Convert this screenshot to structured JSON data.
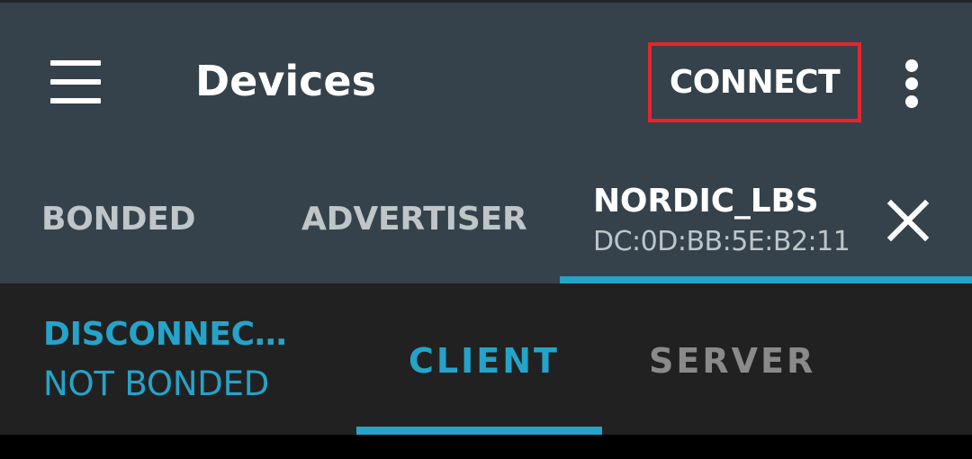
{
  "app_bar": {
    "title": "Devices",
    "menu_icon": "hamburger-menu-icon",
    "connect_label": "CONNECT",
    "overflow_icon": "more-vert-icon"
  },
  "device_tabs": {
    "bonded_label": "BONDED",
    "advertiser_label": "ADVERTISER",
    "active_device_name": "NORDIC_LBS",
    "active_device_address": "DC:0D:BB:5E:B2:11",
    "close_icon": "close-icon"
  },
  "connection": {
    "status": "DISCONNEC…",
    "bond_state": "NOT BONDED"
  },
  "sub_tabs": {
    "client_label": "CLIENT",
    "server_label": "SERVER",
    "selected": "CLIENT"
  },
  "colors": {
    "app_bar_bg": "#35424b",
    "accent": "#26a3c9",
    "highlight_border": "#e4252c",
    "panel_bg": "#212121"
  }
}
